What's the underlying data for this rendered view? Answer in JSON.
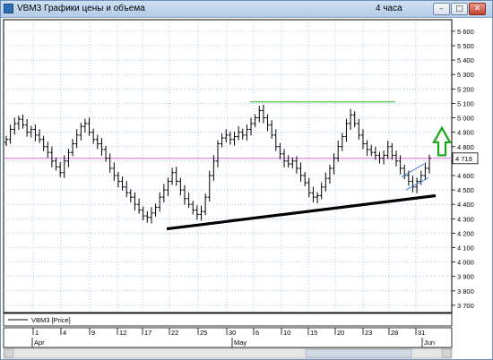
{
  "window": {
    "title": "VBM3 Графики цены и объема",
    "interval": "4 часа",
    "buttons": {
      "minimize": "–",
      "maximize": "□",
      "close": "✕"
    }
  },
  "legend": {
    "series_label": "VBM3 [Price]"
  },
  "colors": {
    "background": "#ffffff",
    "grid": "#7aa7d6",
    "bars": "#000000",
    "resistance_line": "#3fbf3f",
    "support_line": "#000000",
    "current_price_line": "#d86bd8",
    "channel_line": "#4a7fd9",
    "arrow": "#1aa51a"
  },
  "chart_data": {
    "type": "ohlc",
    "title": "",
    "ylabel": "",
    "ylim": [
      3650,
      5680
    ],
    "y_ticks": [
      "5 600",
      "5 500",
      "5 400",
      "5 300",
      "5 200",
      "5 100",
      "5 000",
      "4 900",
      "4 800",
      "4 700",
      "4 600",
      "4 500",
      "4 400",
      "4 300",
      "4 200",
      "4 100",
      "4 000",
      "3 900",
      "3 800",
      "3 700"
    ],
    "current_price": 4719,
    "current_price_label": "4 719",
    "x_day_labels": [
      "1",
      "4",
      "9",
      "12",
      "17",
      "22",
      "25",
      "30",
      "6",
      "10",
      "15",
      "20",
      "23",
      "28",
      "31"
    ],
    "x_month_labels": [
      "Apr",
      "May",
      "Jun"
    ],
    "close_series": [
      4850,
      4920,
      4960,
      4990,
      4950,
      4900,
      4920,
      4880,
      4850,
      4800,
      4760,
      4700,
      4660,
      4620,
      4700,
      4760,
      4820,
      4880,
      4940,
      4960,
      4900,
      4850,
      4820,
      4780,
      4720,
      4650,
      4600,
      4560,
      4520,
      4480,
      4450,
      4400,
      4360,
      4320,
      4310,
      4340,
      4380,
      4450,
      4500,
      4560,
      4620,
      4560,
      4500,
      4440,
      4400,
      4360,
      4330,
      4350,
      4450,
      4600,
      4700,
      4820,
      4860,
      4880,
      4850,
      4870,
      4900,
      4880,
      4920,
      4960,
      5000,
      5050,
      5000,
      4950,
      4880,
      4800,
      4750,
      4700,
      4680,
      4700,
      4650,
      4600,
      4550,
      4480,
      4450,
      4460,
      4520,
      4580,
      4650,
      4720,
      4800,
      4870,
      4960,
      5020,
      4960,
      4880,
      4820,
      4780,
      4760,
      4740,
      4720,
      4740,
      4800,
      4740,
      4700,
      4650,
      4600,
      4560,
      4520,
      4560,
      4600,
      4650,
      4719
    ],
    "resistance_level": 5110,
    "support_trendline": [
      4230,
      4460
    ],
    "annotation": "up-arrow"
  }
}
